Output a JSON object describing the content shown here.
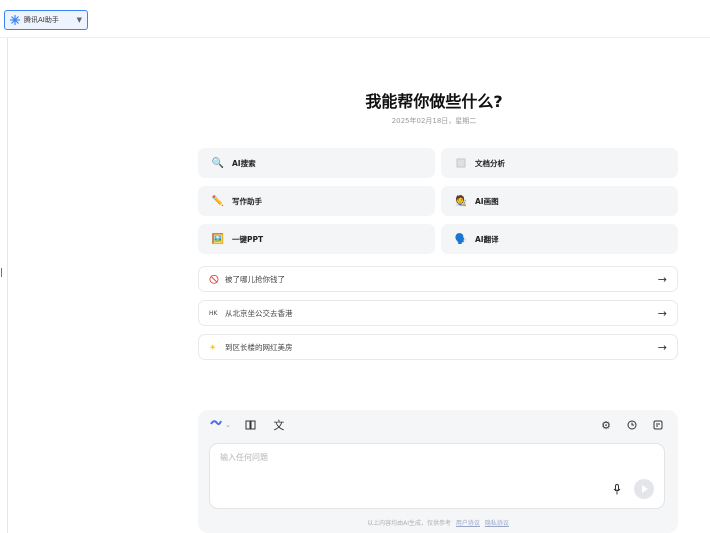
{
  "top_selector": {
    "label": "腾讯AI助手"
  },
  "main": {
    "heading": "我能帮你做些什么?",
    "date": "2025年02月18日，星期二"
  },
  "features": [
    {
      "label": "AI搜索",
      "icon": "magnifier-icon"
    },
    {
      "label": "文档分析",
      "icon": "document-icon"
    },
    {
      "label": "写作助手",
      "icon": "pencil-icon"
    },
    {
      "label": "AI画图",
      "icon": "painter-icon"
    },
    {
      "label": "一键PPT",
      "icon": "picture-icon"
    },
    {
      "label": "AI翻译",
      "icon": "translate-icon"
    }
  ],
  "suggestions": [
    {
      "text": "被了哪儿抢你钱了",
      "icon": "prohibited-icon"
    },
    {
      "text": "从北京坐公交去香港",
      "icon": "hk-icon"
    },
    {
      "text": "到区长楼的网红美房",
      "icon": "sun-icon"
    }
  ],
  "composer": {
    "placeholder": "输入任何问题",
    "disclaimer": "以上内容均由AI生成，仅供参考",
    "links": [
      "用户协议",
      "隐私协议"
    ]
  },
  "colors": {
    "accent": "#4a6cf7",
    "selector_border": "#3b82f6"
  }
}
